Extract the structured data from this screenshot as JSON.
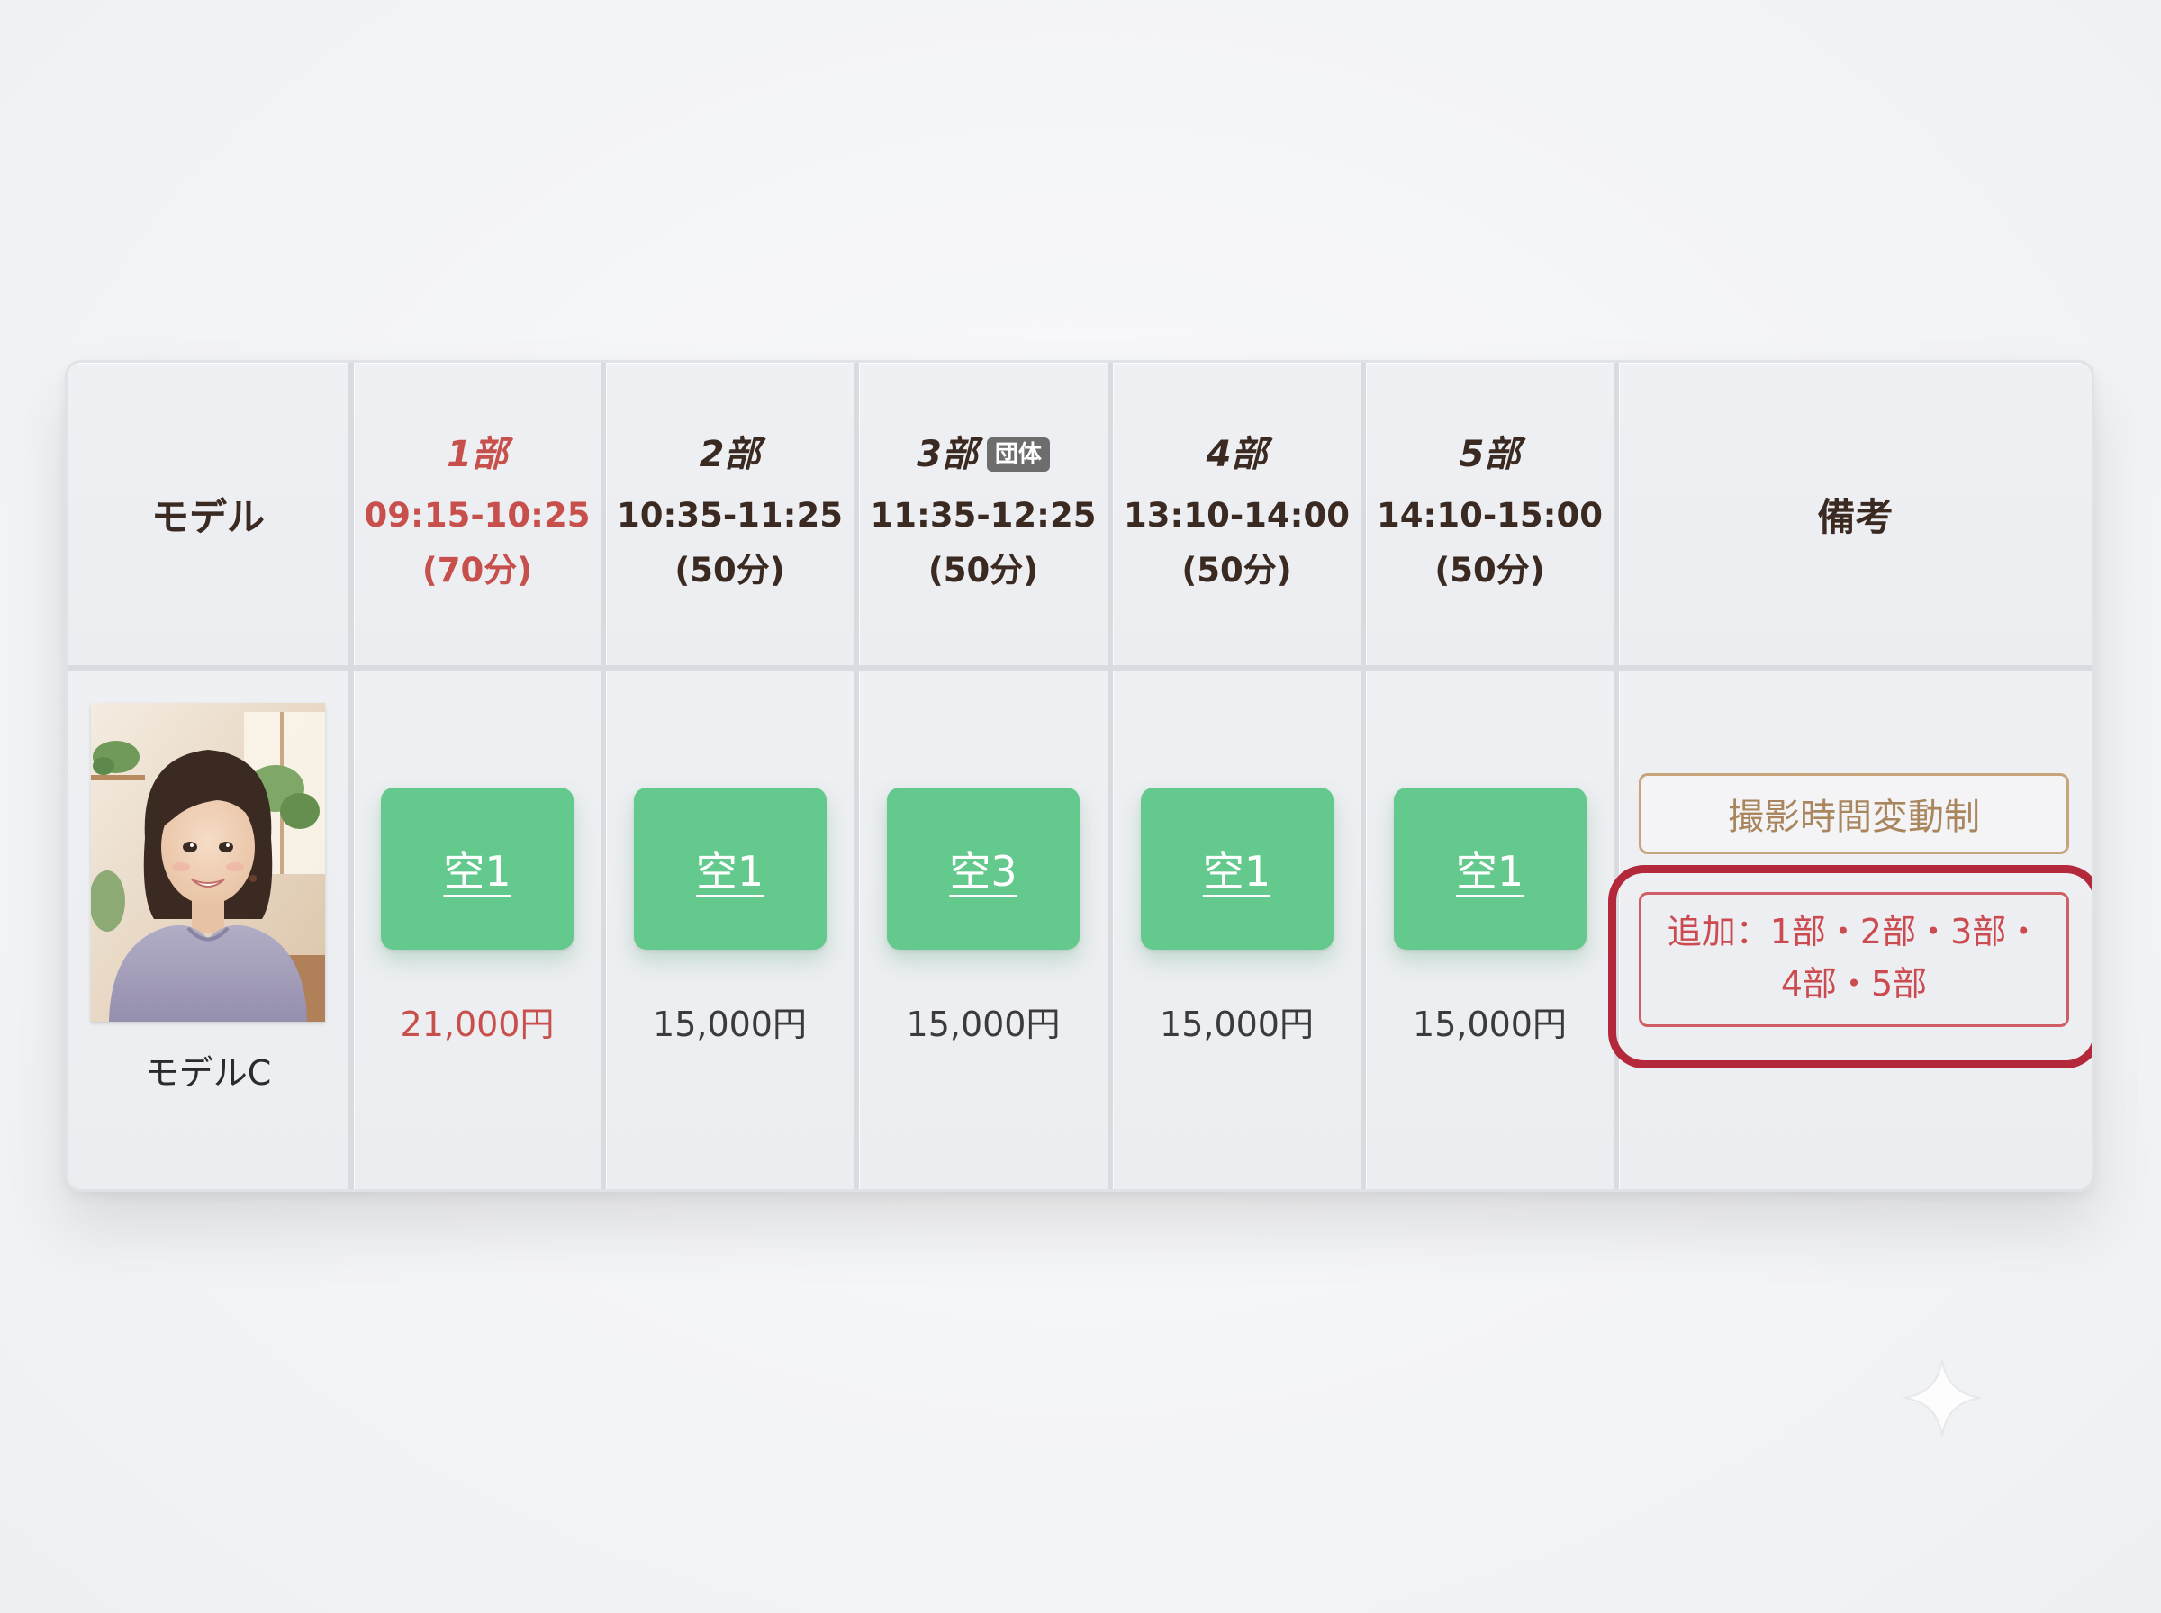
{
  "header": {
    "model_label": "モデル",
    "notes_label": "備考",
    "slots": [
      {
        "part": "1部",
        "time": "09:15-10:25",
        "duration": "(70分)",
        "badge": ""
      },
      {
        "part": "2部",
        "time": "10:35-11:25",
        "duration": "(50分)",
        "badge": ""
      },
      {
        "part": "3部",
        "time": "11:35-12:25",
        "duration": "(50分)",
        "badge": "団体"
      },
      {
        "part": "4部",
        "time": "13:10-14:00",
        "duration": "(50分)",
        "badge": ""
      },
      {
        "part": "5部",
        "time": "14:10-15:00",
        "duration": "(50分)",
        "badge": ""
      }
    ]
  },
  "row": {
    "model_name": "モデルC",
    "slots": [
      {
        "availability": "空1",
        "price": "21,000円"
      },
      {
        "availability": "空1",
        "price": "15,000円"
      },
      {
        "availability": "空3",
        "price": "15,000円"
      },
      {
        "availability": "空1",
        "price": "15,000円"
      },
      {
        "availability": "空1",
        "price": "15,000円"
      }
    ],
    "notes": {
      "tag": "撮影時間変動制",
      "add_line1": "追加：1部・2部・3部・",
      "add_line2": "4部・5部"
    }
  },
  "colors": {
    "accent_red": "#c8504c",
    "slot_green": "#63c98d",
    "highlight_border": "#b3283a",
    "tag_border": "#c6a57c"
  }
}
